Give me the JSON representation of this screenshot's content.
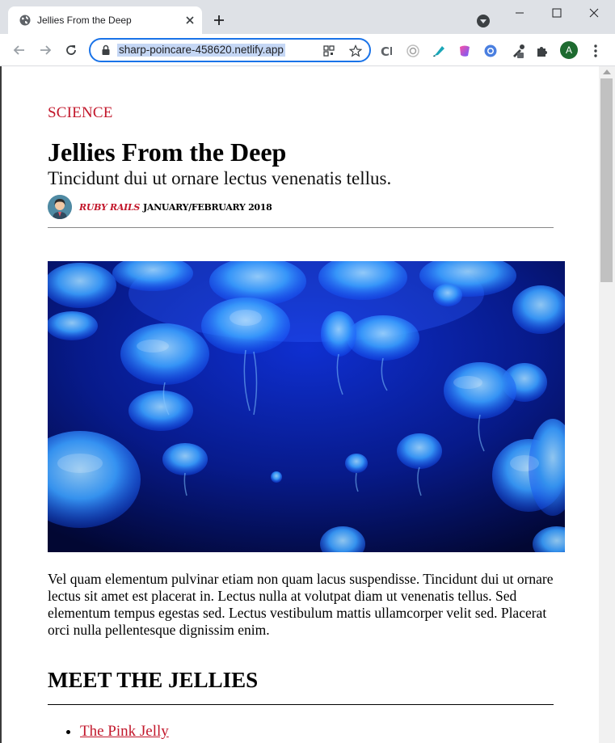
{
  "browser": {
    "tab_title": "Jellies From the Deep",
    "url": "sharp-poincare-458620.netlify.app",
    "profile_initial": "A"
  },
  "article": {
    "category": "SCIENCE",
    "title": "Jellies From the Deep",
    "subtitle": "Tincidunt dui ut ornare lectus venenatis tellus.",
    "author": "RUBY RAILS",
    "issue_date": "JANUARY/FEBRUARY 2018",
    "body": "Vel quam elementum pulvinar etiam non quam lacus suspendisse. Tincidunt dui ut ornare lectus sit amet est placerat in. Lectus nulla at volutpat diam ut venenatis tellus. Sed elementum tempus egestas sed. Lectus vestibulum mattis ullamcorper velit sed. Placerat orci nulla pellentesque dignissim enim.",
    "section_heading": "MEET THE JELLIES",
    "jellies": [
      {
        "label": "The Pink Jelly"
      }
    ]
  },
  "colors": {
    "accent": "#c2172b",
    "omnibox_focus": "#1a73e8"
  }
}
